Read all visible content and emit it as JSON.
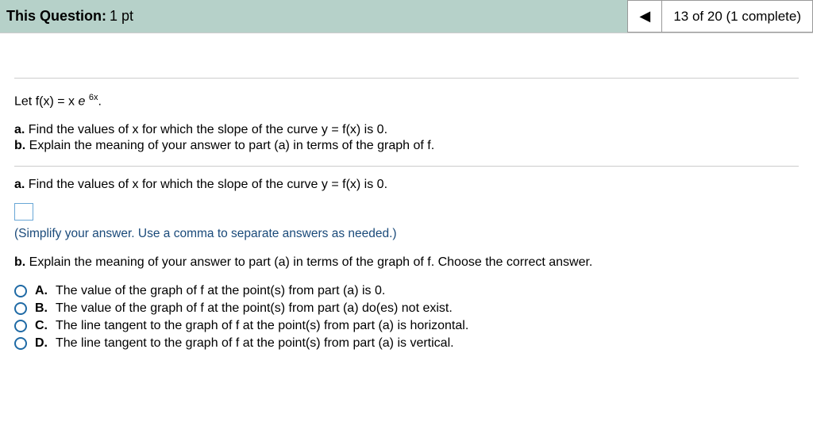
{
  "header": {
    "title_bold": "This Question:",
    "title_rest": "1 pt",
    "nav_prev_glyph": "◀",
    "progress": "13 of 20 (1 complete)"
  },
  "question": {
    "func_prefix": "Let f(x) = x",
    "func_e": "e",
    "func_exp": "6x",
    "func_suffix": ".",
    "part_a_label": "a.",
    "part_a_text": "Find the values of x for which the slope of the curve y = f(x) is 0.",
    "part_b_label": "b.",
    "part_b_text": "Explain the meaning of your answer to part (a) in terms of the graph of f."
  },
  "prompt_a": {
    "label": "a.",
    "text": "Find the values of x for which the slope of the curve y = f(x) is 0.",
    "hint": "(Simplify your answer. Use a comma to separate answers as needed.)"
  },
  "prompt_b": {
    "label": "b.",
    "text": "Explain the meaning of your answer to part (a) in terms of the graph of f. Choose the correct answer."
  },
  "choices": [
    {
      "label": "A.",
      "text": "The value of the graph of f at the point(s) from part (a) is 0."
    },
    {
      "label": "B.",
      "text": "The value of the graph of f at the point(s) from part (a) do(es) not exist."
    },
    {
      "label": "C.",
      "text": "The line tangent to the graph of f at the point(s) from part (a) is horizontal."
    },
    {
      "label": "D.",
      "text": "The line tangent to the graph of f at the point(s) from part (a) is vertical."
    }
  ]
}
